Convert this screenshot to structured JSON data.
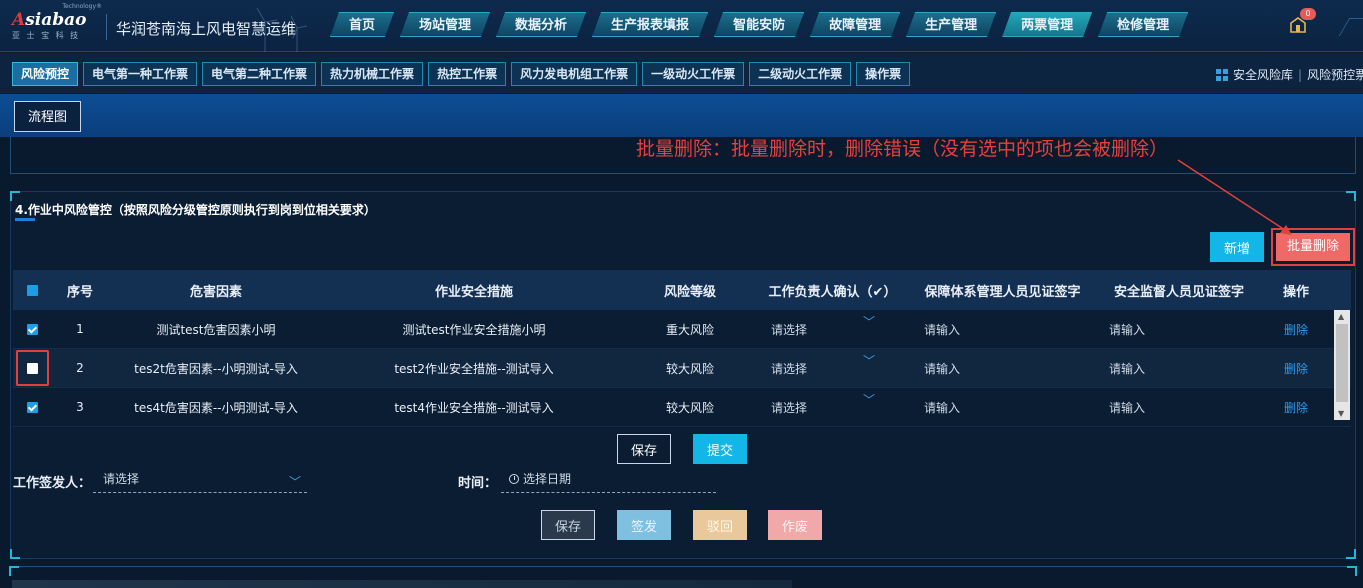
{
  "header": {
    "logo_text": "Asiabao",
    "logo_sub": "亚 士 宝 科 技",
    "logo_tech": "Technology®",
    "system_title": "华润苍南海上风电智慧运维",
    "notification_count": "0",
    "nav": [
      {
        "label": "首页"
      },
      {
        "label": "场站管理"
      },
      {
        "label": "数据分析"
      },
      {
        "label": "生产报表填报"
      },
      {
        "label": "智能安防"
      },
      {
        "label": "故障管理"
      },
      {
        "label": "生产管理"
      },
      {
        "label": "两票管理",
        "active": true
      },
      {
        "label": "检修管理"
      }
    ]
  },
  "subnav": {
    "tabs": [
      {
        "label": "风险预控",
        "active": true
      },
      {
        "label": "电气第一种工作票"
      },
      {
        "label": "电气第二种工作票"
      },
      {
        "label": "热力机械工作票"
      },
      {
        "label": "热控工作票"
      },
      {
        "label": "风力发电机组工作票"
      },
      {
        "label": "一级动火工作票"
      },
      {
        "label": "二级动火工作票"
      },
      {
        "label": "操作票"
      }
    ],
    "right_link_1": "安全风险库",
    "right_sep": "|",
    "right_link_2": "风险预控票"
  },
  "toolbar": {
    "flow_button": "流程图"
  },
  "annotation": "批量删除：批量删除时，删除错误（没有选中的项也会被删除）",
  "section": {
    "title": "4.作业中风险管控（按照风险分级管控原则执行到岗到位相关要求）",
    "add_button": "新增",
    "batch_delete_button": "批量删除",
    "columns": [
      "序号",
      "危害因素",
      "作业安全措施",
      "风险等级",
      "工作负责人确认（✔）",
      "保障体系管理人员见证签字",
      "安全监督人员见证签字",
      "操作"
    ],
    "rows": [
      {
        "checked": true,
        "no": "1",
        "hazard": "测试test危害因素小明",
        "measure": "测试test作业安全措施小明",
        "level": "重大风险",
        "confirm": "请选择",
        "witness1": "请输入",
        "witness2": "请输入",
        "action": "删除"
      },
      {
        "checked": false,
        "no": "2",
        "hazard": "tes2t危害因素--小明测试-导入",
        "measure": "test2作业安全措施--测试导入",
        "level": "较大风险",
        "confirm": "请选择",
        "witness1": "请输入",
        "witness2": "请输入",
        "action": "删除"
      },
      {
        "checked": true,
        "no": "3",
        "hazard": "tes4t危害因素--小明测试-导入",
        "measure": "test4作业安全措施--测试导入",
        "level": "较大风险",
        "confirm": "请选择",
        "witness1": "请输入",
        "witness2": "请输入",
        "action": "删除"
      }
    ],
    "save_button": "保存",
    "submit_button": "提交",
    "signer_label": "工作签发人：",
    "signer_placeholder": "请选择",
    "time_label": "时间：",
    "time_placeholder": "选择日期",
    "bottom_buttons": {
      "save": "保存",
      "sign": "签发",
      "reject": "驳回",
      "void": "作废"
    }
  },
  "colors": {
    "accent": "#12b7e8",
    "danger": "#e3403b",
    "background": "#0a1a2e"
  }
}
